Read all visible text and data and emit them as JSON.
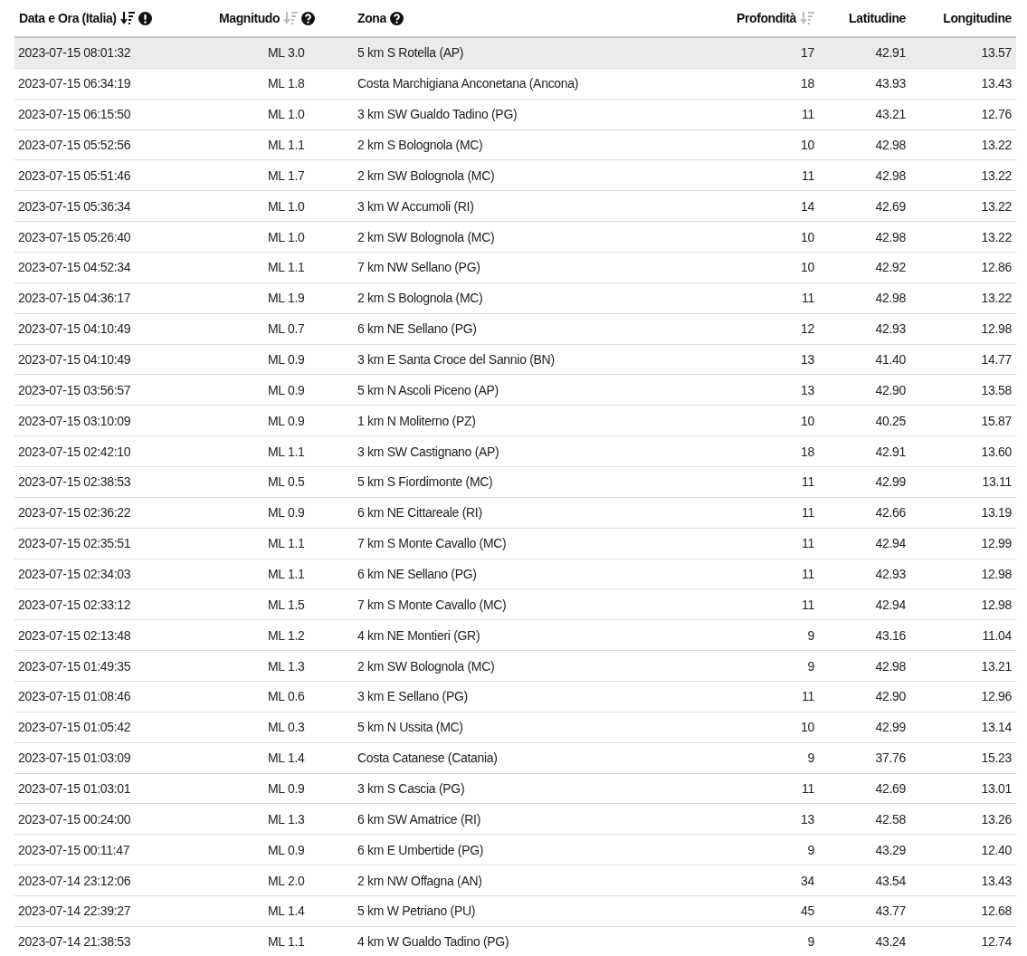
{
  "table": {
    "columns": [
      {
        "label": "Data e Ora (Italia)",
        "sortable": true,
        "sorted": true,
        "info_icon": true
      },
      {
        "label": "Magnitudo",
        "sortable": true,
        "sorted": false,
        "help_icon": true
      },
      {
        "label": "Zona",
        "help_icon": true
      },
      {
        "label": "Profondità",
        "sortable": true,
        "sorted": false
      },
      {
        "label": "Latitudine"
      },
      {
        "label": "Longitudine"
      }
    ],
    "rows": [
      {
        "selected": true,
        "cells": [
          "2023-07-15 08:01:32",
          "ML 3.0",
          "5 km S Rotella (AP)",
          "17",
          "42.91",
          "13.57"
        ]
      },
      {
        "selected": false,
        "cells": [
          "2023-07-15 06:34:19",
          "ML 1.8",
          "Costa Marchigiana Anconetana (Ancona)",
          "18",
          "43.93",
          "13.43"
        ]
      },
      {
        "selected": false,
        "cells": [
          "2023-07-15 06:15:50",
          "ML 1.0",
          "3 km SW Gualdo Tadino (PG)",
          "11",
          "43.21",
          "12.76"
        ]
      },
      {
        "selected": false,
        "cells": [
          "2023-07-15 05:52:56",
          "ML 1.1",
          "2 km S Bolognola (MC)",
          "10",
          "42.98",
          "13.22"
        ]
      },
      {
        "selected": false,
        "cells": [
          "2023-07-15 05:51:46",
          "ML 1.7",
          "2 km SW Bolognola (MC)",
          "11",
          "42.98",
          "13.22"
        ]
      },
      {
        "selected": false,
        "cells": [
          "2023-07-15 05:36:34",
          "ML 1.0",
          "3 km W Accumoli (RI)",
          "14",
          "42.69",
          "13.22"
        ]
      },
      {
        "selected": false,
        "cells": [
          "2023-07-15 05:26:40",
          "ML 1.0",
          "2 km SW Bolognola (MC)",
          "10",
          "42.98",
          "13.22"
        ]
      },
      {
        "selected": false,
        "cells": [
          "2023-07-15 04:52:34",
          "ML 1.1",
          "7 km NW Sellano (PG)",
          "10",
          "42.92",
          "12.86"
        ]
      },
      {
        "selected": false,
        "cells": [
          "2023-07-15 04:36:17",
          "ML 1.9",
          "2 km S Bolognola (MC)",
          "11",
          "42.98",
          "13.22"
        ]
      },
      {
        "selected": false,
        "cells": [
          "2023-07-15 04:10:49",
          "ML 0.7",
          "6 km NE Sellano (PG)",
          "12",
          "42.93",
          "12.98"
        ]
      },
      {
        "selected": false,
        "cells": [
          "2023-07-15 04:10:49",
          "ML 0.9",
          "3 km E Santa Croce del Sannio (BN)",
          "13",
          "41.40",
          "14.77"
        ]
      },
      {
        "selected": false,
        "cells": [
          "2023-07-15 03:56:57",
          "ML 0.9",
          "5 km N Ascoli Piceno (AP)",
          "13",
          "42.90",
          "13.58"
        ]
      },
      {
        "selected": false,
        "cells": [
          "2023-07-15 03:10:09",
          "ML 0.9",
          "1 km N Moliterno (PZ)",
          "10",
          "40.25",
          "15.87"
        ]
      },
      {
        "selected": false,
        "cells": [
          "2023-07-15 02:42:10",
          "ML 1.1",
          "3 km SW Castignano (AP)",
          "18",
          "42.91",
          "13.60"
        ]
      },
      {
        "selected": false,
        "cells": [
          "2023-07-15 02:38:53",
          "ML 0.5",
          "5 km S Fiordimonte (MC)",
          "11",
          "42.99",
          "13.11"
        ]
      },
      {
        "selected": false,
        "cells": [
          "2023-07-15 02:36:22",
          "ML 0.9",
          "6 km NE Cittareale (RI)",
          "11",
          "42.66",
          "13.19"
        ]
      },
      {
        "selected": false,
        "cells": [
          "2023-07-15 02:35:51",
          "ML 1.1",
          "7 km S Monte Cavallo (MC)",
          "11",
          "42.94",
          "12.99"
        ]
      },
      {
        "selected": false,
        "cells": [
          "2023-07-15 02:34:03",
          "ML 1.1",
          "6 km NE Sellano (PG)",
          "11",
          "42.93",
          "12.98"
        ]
      },
      {
        "selected": false,
        "cells": [
          "2023-07-15 02:33:12",
          "ML 1.5",
          "7 km S Monte Cavallo (MC)",
          "11",
          "42.94",
          "12.98"
        ]
      },
      {
        "selected": false,
        "cells": [
          "2023-07-15 02:13:48",
          "ML 1.2",
          "4 km NE Montieri (GR)",
          "9",
          "43.16",
          "11.04"
        ]
      },
      {
        "selected": false,
        "cells": [
          "2023-07-15 01:49:35",
          "ML 1.3",
          "2 km SW Bolognola (MC)",
          "9",
          "42.98",
          "13.21"
        ]
      },
      {
        "selected": false,
        "cells": [
          "2023-07-15 01:08:46",
          "ML 0.6",
          "3 km E Sellano (PG)",
          "11",
          "42.90",
          "12.96"
        ]
      },
      {
        "selected": false,
        "cells": [
          "2023-07-15 01:05:42",
          "ML 0.3",
          "5 km N Ussita (MC)",
          "10",
          "42.99",
          "13.14"
        ]
      },
      {
        "selected": false,
        "cells": [
          "2023-07-15 01:03:09",
          "ML 1.4",
          "Costa Catanese (Catania)",
          "9",
          "37.76",
          "15.23"
        ]
      },
      {
        "selected": false,
        "cells": [
          "2023-07-15 01:03:01",
          "ML 0.9",
          "3 km S Cascia (PG)",
          "11",
          "42.69",
          "13.01"
        ]
      },
      {
        "selected": false,
        "cells": [
          "2023-07-15 00:24:00",
          "ML 1.3",
          "6 km SW Amatrice (RI)",
          "13",
          "42.58",
          "13.26"
        ]
      },
      {
        "selected": false,
        "cells": [
          "2023-07-15 00:11:47",
          "ML 0.9",
          "6 km E Umbertide (PG)",
          "9",
          "43.29",
          "12.40"
        ]
      },
      {
        "selected": false,
        "cells": [
          "2023-07-14 23:12:06",
          "ML 2.0",
          "2 km NW Offagna (AN)",
          "34",
          "43.54",
          "13.43"
        ]
      },
      {
        "selected": false,
        "cells": [
          "2023-07-14 22:39:27",
          "ML 1.4",
          "5 km W Petriano (PU)",
          "45",
          "43.77",
          "12.68"
        ]
      },
      {
        "selected": false,
        "cells": [
          "2023-07-14 21:38:53",
          "ML 1.1",
          "4 km W Gualdo Tadino (PG)",
          "9",
          "43.24",
          "12.74"
        ]
      }
    ]
  }
}
